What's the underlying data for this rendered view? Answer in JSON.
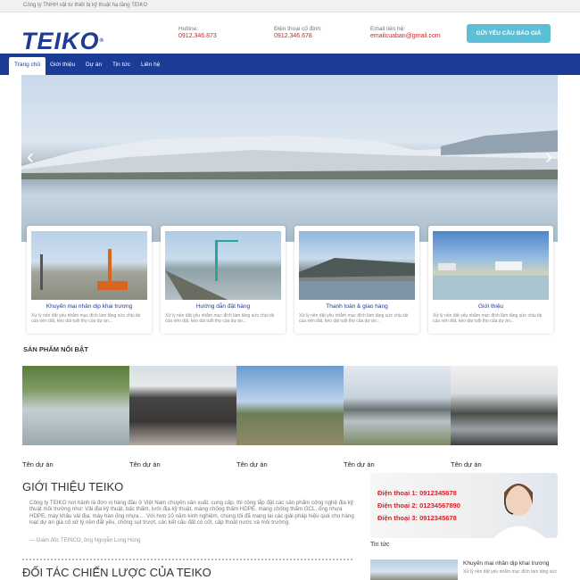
{
  "topbar": {
    "company": "Công ty TNHH vật tư thiết bị kỹ thuật hạ tầng TEIKO"
  },
  "header": {
    "logo": "TEIKO",
    "logo_mark": "®",
    "contacts": [
      {
        "label": "Hotline:",
        "value": "0912.346.873"
      },
      {
        "label": "Điện thoại cố định:",
        "value": "0912.346.678"
      },
      {
        "label": "Email liên hệ:",
        "value": "emailcuaban@gmail.com"
      }
    ],
    "quote_button": "GỬI YÊU CẦU BÁO GIÁ"
  },
  "nav": {
    "items": [
      "Trang chủ",
      "Giới thiệu",
      "Dự án",
      "Tin tức",
      "Liên hệ"
    ],
    "active_index": 0
  },
  "slider": {
    "prev_symbol": "‹",
    "next_symbol": "›"
  },
  "features": [
    {
      "title": "Khuyến mại nhân dịp khai trương",
      "desc": "Xử lý nền đất yếu nhằm mục đích làm tăng sức chịu tải của nền đất, kéo dài tuổi thọ của dự án..."
    },
    {
      "title": "Hướng dẫn đặt hàng",
      "desc": "Xử lý nền đất yếu nhằm mục đích làm tăng sức chịu tải của nền đất, kéo dài tuổi thọ của dự án..."
    },
    {
      "title": "Thanh toán & giao hàng",
      "desc": "Xử lý nền đất yếu nhằm mục đích làm tăng sức chịu tải của nền đất, kéo dài tuổi thọ của dự án..."
    },
    {
      "title": "Giới thiệu",
      "desc": "Xử lý nền đất yếu nhằm mục đích làm tăng sức chịu tải của nền đất, kéo dài tuổi thọ của dự án..."
    }
  ],
  "featured": {
    "title": "SẢN PHẨM NỔI BẬT",
    "items": [
      "Tên dự án",
      "Tên dự án",
      "Tên dự án",
      "Tên dự án",
      "Tên dự án"
    ]
  },
  "about": {
    "title": "GIỚI THIỆU TEIKO",
    "text": "Công ty TEIKO nơi hành là đơn vị hàng đầu ở Việt Nam chuyên sản xuất, cung cấp, thi công lắp đặt các sản phẩm công nghệ địa kỹ thuật môi trường như: Vải địa kỹ thuật, bấc thấm, lưới địa kỹ thuật, màng chống thấm HDPE, màng chống thấm GCL, ống nhựa HDPE, máy khâu vải địa, máy hàn ống nhựa ... Với hơn 10 năm kinh nghiệm, chúng tôi đã mang lại các giải pháp hiệu quả cho hàng loạt dự án gia cố xử lý nền đất yếu, chống sụt trượt, các kết cấu đất có cốt, cấp thoát nước và môi trường.",
    "signature": "— Giám đốc TEINCO, ông Nguyễn Long Hùng"
  },
  "partners": {
    "title": "ĐỐI TÁC CHIẾN LƯỢC CỦA TEIKO"
  },
  "support": {
    "lines": [
      "Điện thoại 1: 0912345678",
      "Điện thoại 2: 01234567890",
      "Điện thoại 3: 0912345678"
    ]
  },
  "news": {
    "title": "Tin tức",
    "items": [
      {
        "title": "Khuyến mại nhân dịp khai trương",
        "desc": "Xử lý nền đất yếu nhằm mục đích làm tăng sức"
      }
    ]
  }
}
